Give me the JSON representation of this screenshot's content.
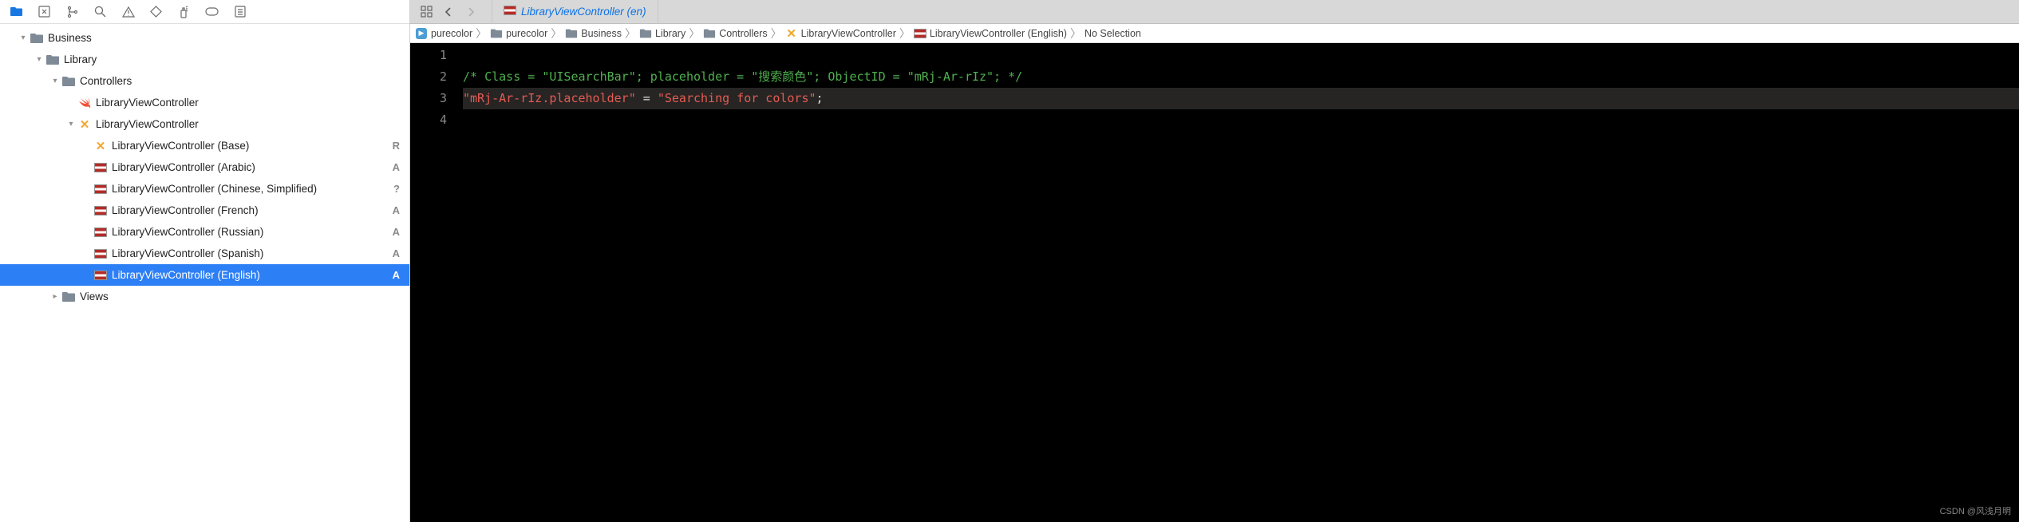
{
  "toolbar_icons": [
    "folder-icon",
    "square-x-icon",
    "scm-icon",
    "search-icon",
    "warning-icon",
    "diamond-icon",
    "spray-icon",
    "pill-icon",
    "list-icon"
  ],
  "tree": [
    {
      "depth": 0,
      "chevron": "down",
      "icon": "folder",
      "label": "Business",
      "badge": "",
      "selected": false
    },
    {
      "depth": 1,
      "chevron": "down",
      "icon": "folder",
      "label": "Library",
      "badge": "",
      "selected": false
    },
    {
      "depth": 2,
      "chevron": "down",
      "icon": "folder",
      "label": "Controllers",
      "badge": "",
      "selected": false
    },
    {
      "depth": 3,
      "chevron": "",
      "icon": "swift",
      "label": "LibraryViewController",
      "badge": "",
      "selected": false
    },
    {
      "depth": 3,
      "chevron": "down",
      "icon": "xib",
      "label": "LibraryViewController",
      "badge": "",
      "selected": false
    },
    {
      "depth": 4,
      "chevron": "",
      "icon": "xib",
      "label": "LibraryViewController (Base)",
      "badge": "R",
      "selected": false
    },
    {
      "depth": 4,
      "chevron": "",
      "icon": "strings",
      "label": "LibraryViewController (Arabic)",
      "badge": "A",
      "selected": false
    },
    {
      "depth": 4,
      "chevron": "",
      "icon": "strings",
      "label": "LibraryViewController (Chinese, Simplified)",
      "badge": "?",
      "selected": false
    },
    {
      "depth": 4,
      "chevron": "",
      "icon": "strings",
      "label": "LibraryViewController (French)",
      "badge": "A",
      "selected": false
    },
    {
      "depth": 4,
      "chevron": "",
      "icon": "strings",
      "label": "LibraryViewController (Russian)",
      "badge": "A",
      "selected": false
    },
    {
      "depth": 4,
      "chevron": "",
      "icon": "strings",
      "label": "LibraryViewController (Spanish)",
      "badge": "A",
      "selected": false
    },
    {
      "depth": 4,
      "chevron": "",
      "icon": "strings",
      "label": "LibraryViewController (English)",
      "badge": "A",
      "selected": true
    },
    {
      "depth": 2,
      "chevron": "right",
      "icon": "folder",
      "label": "Views",
      "badge": "",
      "selected": false
    }
  ],
  "tab": {
    "label": "LibraryViewController (en)"
  },
  "breadcrumb": [
    {
      "icon": "app",
      "label": "purecolor"
    },
    {
      "icon": "folder",
      "label": "purecolor"
    },
    {
      "icon": "folder",
      "label": "Business"
    },
    {
      "icon": "folder",
      "label": "Library"
    },
    {
      "icon": "folder",
      "label": "Controllers"
    },
    {
      "icon": "xib",
      "label": "LibraryViewController"
    },
    {
      "icon": "strings",
      "label": "LibraryViewController (English)"
    },
    {
      "icon": "",
      "label": "No Selection"
    }
  ],
  "code": {
    "lines": [
      {
        "n": "1",
        "type": "empty",
        "content": ""
      },
      {
        "n": "2",
        "type": "comment",
        "content": "/* Class = \"UISearchBar\"; placeholder = \"搜索颜色\"; ObjectID = \"mRj-Ar-rIz\"; */"
      },
      {
        "n": "3",
        "type": "kv",
        "key": "\"mRj-Ar-rIz.placeholder\"",
        "eq": " = ",
        "val": "\"Searching for colors\"",
        "semi": ";",
        "current": true
      },
      {
        "n": "4",
        "type": "empty",
        "content": ""
      }
    ]
  },
  "watermark": "CSDN @风浅月明"
}
